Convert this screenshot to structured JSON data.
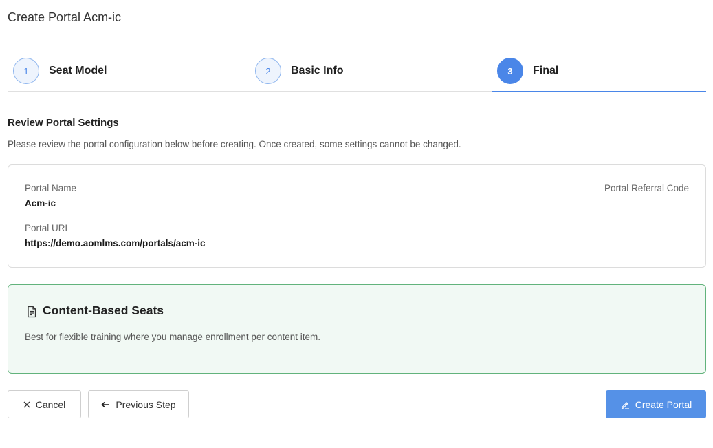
{
  "page": {
    "title": "Create Portal Acm-ic"
  },
  "stepper": {
    "steps": [
      {
        "number": "1",
        "label": "Seat Model",
        "state": "completed"
      },
      {
        "number": "2",
        "label": "Basic Info",
        "state": "completed"
      },
      {
        "number": "3",
        "label": "Final",
        "state": "active"
      }
    ]
  },
  "review": {
    "title": "Review Portal Settings",
    "description": "Please review the portal configuration below before creating. Once created, some settings cannot be changed.",
    "portal_name_label": "Portal Name",
    "portal_name_value": "Acm-ic",
    "portal_url_label": "Portal URL",
    "portal_url_value": "https://demo.aomlms.com/portals/acm-ic",
    "referral_code_label": "Portal Referral Code"
  },
  "seat_model": {
    "icon": "document-icon",
    "title": "Content-Based Seats",
    "description": "Best for flexible training where you manage enrollment per content item."
  },
  "actions": {
    "cancel_label": "Cancel",
    "cancel_icon": "close-icon",
    "previous_label": "Previous Step",
    "previous_icon": "arrow-left-icon",
    "create_label": "Create Portal",
    "create_icon": "pencil-icon"
  },
  "colors": {
    "accent": "#4a86e8",
    "primary_button": "#5591e7",
    "success_border": "#62b37c",
    "success_background": "#f1f9f4"
  }
}
